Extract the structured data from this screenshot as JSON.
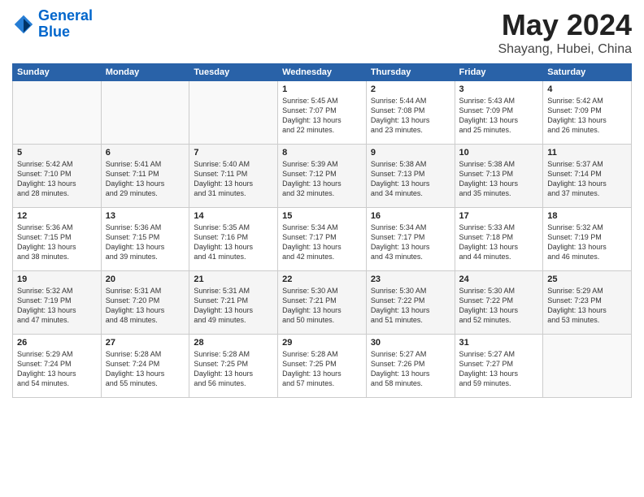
{
  "header": {
    "logo_line1": "General",
    "logo_line2": "Blue",
    "month": "May 2024",
    "location": "Shayang, Hubei, China"
  },
  "weekdays": [
    "Sunday",
    "Monday",
    "Tuesday",
    "Wednesday",
    "Thursday",
    "Friday",
    "Saturday"
  ],
  "weeks": [
    [
      {
        "day": "",
        "info": ""
      },
      {
        "day": "",
        "info": ""
      },
      {
        "day": "",
        "info": ""
      },
      {
        "day": "1",
        "info": "Sunrise: 5:45 AM\nSunset: 7:07 PM\nDaylight: 13 hours\nand 22 minutes."
      },
      {
        "day": "2",
        "info": "Sunrise: 5:44 AM\nSunset: 7:08 PM\nDaylight: 13 hours\nand 23 minutes."
      },
      {
        "day": "3",
        "info": "Sunrise: 5:43 AM\nSunset: 7:09 PM\nDaylight: 13 hours\nand 25 minutes."
      },
      {
        "day": "4",
        "info": "Sunrise: 5:42 AM\nSunset: 7:09 PM\nDaylight: 13 hours\nand 26 minutes."
      }
    ],
    [
      {
        "day": "5",
        "info": "Sunrise: 5:42 AM\nSunset: 7:10 PM\nDaylight: 13 hours\nand 28 minutes."
      },
      {
        "day": "6",
        "info": "Sunrise: 5:41 AM\nSunset: 7:11 PM\nDaylight: 13 hours\nand 29 minutes."
      },
      {
        "day": "7",
        "info": "Sunrise: 5:40 AM\nSunset: 7:11 PM\nDaylight: 13 hours\nand 31 minutes."
      },
      {
        "day": "8",
        "info": "Sunrise: 5:39 AM\nSunset: 7:12 PM\nDaylight: 13 hours\nand 32 minutes."
      },
      {
        "day": "9",
        "info": "Sunrise: 5:38 AM\nSunset: 7:13 PM\nDaylight: 13 hours\nand 34 minutes."
      },
      {
        "day": "10",
        "info": "Sunrise: 5:38 AM\nSunset: 7:13 PM\nDaylight: 13 hours\nand 35 minutes."
      },
      {
        "day": "11",
        "info": "Sunrise: 5:37 AM\nSunset: 7:14 PM\nDaylight: 13 hours\nand 37 minutes."
      }
    ],
    [
      {
        "day": "12",
        "info": "Sunrise: 5:36 AM\nSunset: 7:15 PM\nDaylight: 13 hours\nand 38 minutes."
      },
      {
        "day": "13",
        "info": "Sunrise: 5:36 AM\nSunset: 7:15 PM\nDaylight: 13 hours\nand 39 minutes."
      },
      {
        "day": "14",
        "info": "Sunrise: 5:35 AM\nSunset: 7:16 PM\nDaylight: 13 hours\nand 41 minutes."
      },
      {
        "day": "15",
        "info": "Sunrise: 5:34 AM\nSunset: 7:17 PM\nDaylight: 13 hours\nand 42 minutes."
      },
      {
        "day": "16",
        "info": "Sunrise: 5:34 AM\nSunset: 7:17 PM\nDaylight: 13 hours\nand 43 minutes."
      },
      {
        "day": "17",
        "info": "Sunrise: 5:33 AM\nSunset: 7:18 PM\nDaylight: 13 hours\nand 44 minutes."
      },
      {
        "day": "18",
        "info": "Sunrise: 5:32 AM\nSunset: 7:19 PM\nDaylight: 13 hours\nand 46 minutes."
      }
    ],
    [
      {
        "day": "19",
        "info": "Sunrise: 5:32 AM\nSunset: 7:19 PM\nDaylight: 13 hours\nand 47 minutes."
      },
      {
        "day": "20",
        "info": "Sunrise: 5:31 AM\nSunset: 7:20 PM\nDaylight: 13 hours\nand 48 minutes."
      },
      {
        "day": "21",
        "info": "Sunrise: 5:31 AM\nSunset: 7:21 PM\nDaylight: 13 hours\nand 49 minutes."
      },
      {
        "day": "22",
        "info": "Sunrise: 5:30 AM\nSunset: 7:21 PM\nDaylight: 13 hours\nand 50 minutes."
      },
      {
        "day": "23",
        "info": "Sunrise: 5:30 AM\nSunset: 7:22 PM\nDaylight: 13 hours\nand 51 minutes."
      },
      {
        "day": "24",
        "info": "Sunrise: 5:30 AM\nSunset: 7:22 PM\nDaylight: 13 hours\nand 52 minutes."
      },
      {
        "day": "25",
        "info": "Sunrise: 5:29 AM\nSunset: 7:23 PM\nDaylight: 13 hours\nand 53 minutes."
      }
    ],
    [
      {
        "day": "26",
        "info": "Sunrise: 5:29 AM\nSunset: 7:24 PM\nDaylight: 13 hours\nand 54 minutes."
      },
      {
        "day": "27",
        "info": "Sunrise: 5:28 AM\nSunset: 7:24 PM\nDaylight: 13 hours\nand 55 minutes."
      },
      {
        "day": "28",
        "info": "Sunrise: 5:28 AM\nSunset: 7:25 PM\nDaylight: 13 hours\nand 56 minutes."
      },
      {
        "day": "29",
        "info": "Sunrise: 5:28 AM\nSunset: 7:25 PM\nDaylight: 13 hours\nand 57 minutes."
      },
      {
        "day": "30",
        "info": "Sunrise: 5:27 AM\nSunset: 7:26 PM\nDaylight: 13 hours\nand 58 minutes."
      },
      {
        "day": "31",
        "info": "Sunrise: 5:27 AM\nSunset: 7:27 PM\nDaylight: 13 hours\nand 59 minutes."
      },
      {
        "day": "",
        "info": ""
      }
    ]
  ]
}
